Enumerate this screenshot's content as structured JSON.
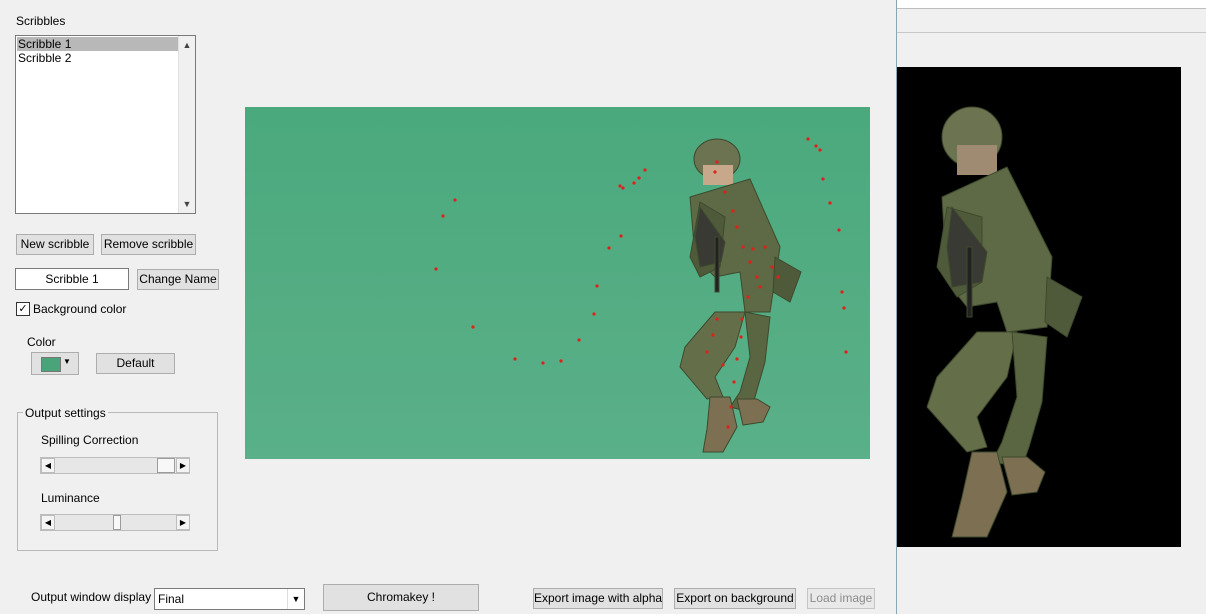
{
  "scribbles": {
    "title": "Scribbles",
    "items": [
      "Scribble 1",
      "Scribble 2"
    ],
    "selected_index": 0
  },
  "buttons": {
    "new_scribble": "New scribble",
    "remove_scribble": "Remove scribble",
    "change_name": "Change Name",
    "default": "Default",
    "chromakey": "Chromakey !",
    "export_alpha": "Export image with alpha",
    "export_background": "Export on background",
    "load_image": "Load image"
  },
  "name_field": {
    "value": "Scribble 1"
  },
  "background_color": {
    "label": "Background color",
    "checked": true
  },
  "color": {
    "label": "Color",
    "value": "#4aa47a"
  },
  "output_settings": {
    "title": "Output settings",
    "spilling_correction": {
      "label": "Spilling Correction",
      "value": 0.83
    },
    "luminance": {
      "label": "Luminance",
      "value": 0.5
    }
  },
  "output_window_display": {
    "label": "Output window display",
    "value": "Final"
  },
  "icons": {
    "scroll_up": "chevron-up-icon",
    "scroll_down": "chevron-down-icon",
    "slider_left": "arrow-left-icon",
    "slider_right": "arrow-right-icon",
    "dropdown": "chevron-down-icon",
    "check": "check-icon"
  },
  "colors": {
    "green_screen": "#55ab83",
    "scribble_points": "#e0201a",
    "output_background": "#000000",
    "soldier": "#5e6a46"
  }
}
